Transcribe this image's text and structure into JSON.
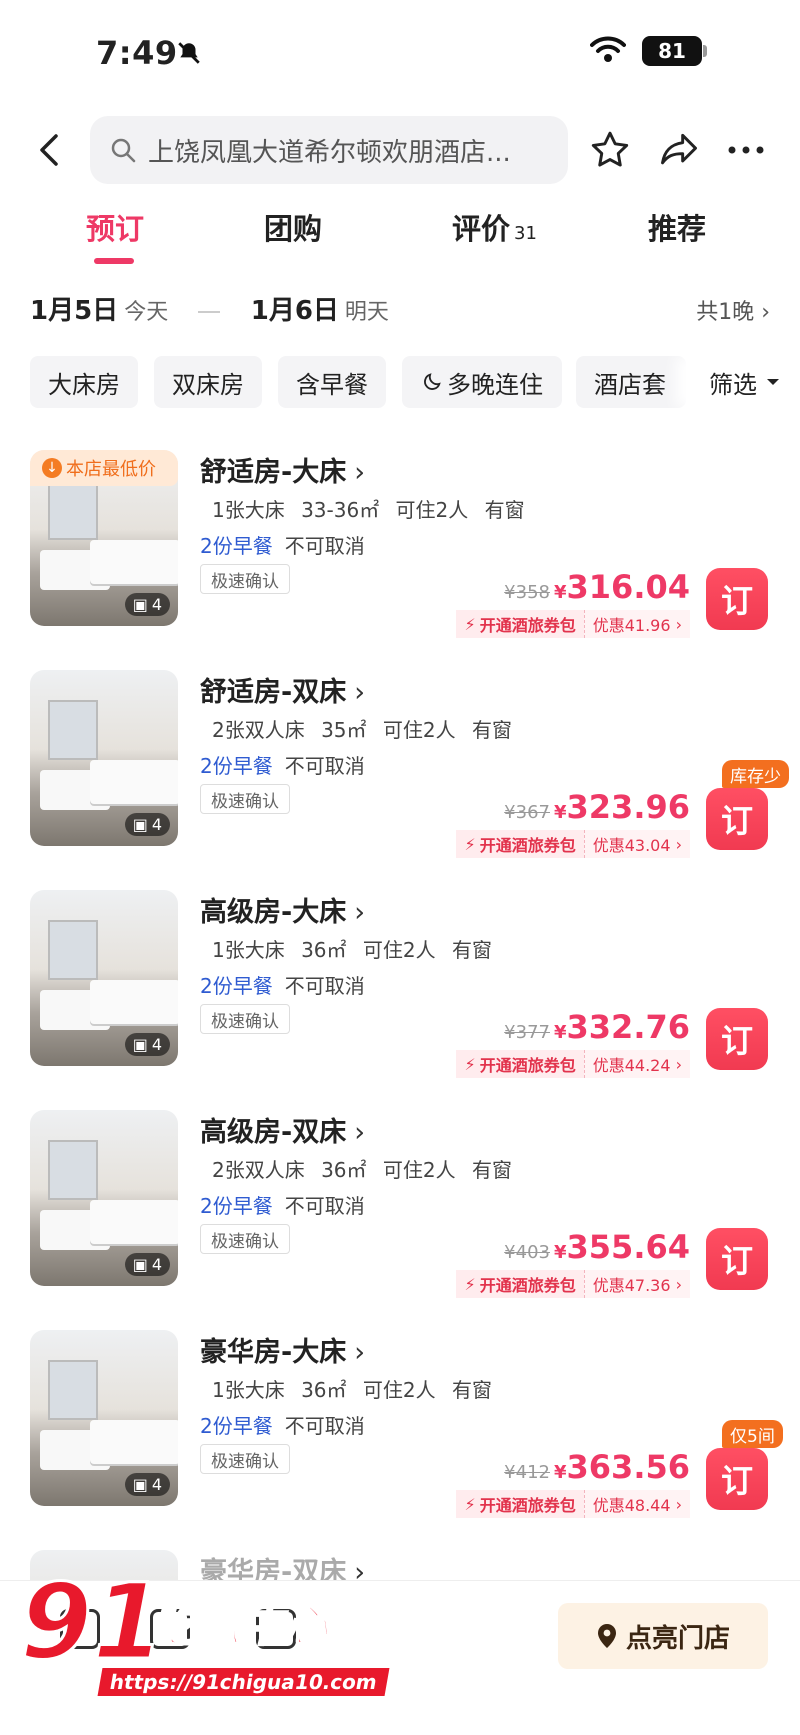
{
  "status_bar": {
    "time": "7:49",
    "battery": "81"
  },
  "header": {
    "search_text": "上饶凤凰大道希尔顿欢朋酒店..."
  },
  "tabs": [
    {
      "label": "预订",
      "count": ""
    },
    {
      "label": "团购",
      "count": ""
    },
    {
      "label": "评价",
      "count": "31"
    },
    {
      "label": "推荐",
      "count": ""
    }
  ],
  "dates": {
    "checkin": "1月5日",
    "checkin_sub": "今天",
    "checkout": "1月6日",
    "checkout_sub": "明天",
    "nights": "共1晚"
  },
  "filters": [
    "大床房",
    "双床房",
    "含早餐",
    "多晚连住",
    "酒店套"
  ],
  "filter_button": "筛选",
  "rooms": [
    {
      "badge": "本店最低价",
      "name": "舒适房-大床",
      "specs": "1张大床 33-36㎡ 可住2人 有窗",
      "breakfast": "2份早餐",
      "cancel": "不可取消",
      "fast": "极速确认",
      "orig": "¥358",
      "price": "316.04",
      "promo_a": "开通酒旅券包",
      "promo_b": "优惠41.96",
      "photos": "4",
      "tag": ""
    },
    {
      "badge": "",
      "name": "舒适房-双床",
      "specs": "2张双人床 35㎡ 可住2人 有窗",
      "breakfast": "2份早餐",
      "cancel": "不可取消",
      "fast": "极速确认",
      "orig": "¥367",
      "price": "323.96",
      "promo_a": "开通酒旅券包",
      "promo_b": "优惠43.04",
      "photos": "4",
      "tag": "库存少"
    },
    {
      "badge": "",
      "name": "高级房-大床",
      "specs": "1张大床 36㎡ 可住2人 有窗",
      "breakfast": "2份早餐",
      "cancel": "不可取消",
      "fast": "极速确认",
      "orig": "¥377",
      "price": "332.76",
      "promo_a": "开通酒旅券包",
      "promo_b": "优惠44.24",
      "photos": "4",
      "tag": ""
    },
    {
      "badge": "",
      "name": "高级房-双床",
      "specs": "2张双人床 36㎡ 可住2人 有窗",
      "breakfast": "2份早餐",
      "cancel": "不可取消",
      "fast": "极速确认",
      "orig": "¥403",
      "price": "355.64",
      "promo_a": "开通酒旅券包",
      "promo_b": "优惠47.36",
      "photos": "4",
      "tag": ""
    },
    {
      "badge": "",
      "name": "豪华房-大床",
      "specs": "1张大床 36㎡ 可住2人 有窗",
      "breakfast": "2份早餐",
      "cancel": "不可取消",
      "fast": "极速确认",
      "orig": "¥412",
      "price": "363.56",
      "promo_a": "开通酒旅券包",
      "promo_b": "优惠48.44",
      "photos": "4",
      "tag": "仅5间"
    },
    {
      "badge": "",
      "name": "豪华房-双床",
      "specs": "",
      "breakfast": "",
      "cancel": "",
      "fast": "",
      "orig": "",
      "price": "",
      "promo_a": "",
      "promo_b": "",
      "photos": "",
      "tag": ""
    }
  ],
  "book_label": "订",
  "currency": "¥",
  "bottom": {
    "light_store": "点亮门店"
  },
  "watermark": {
    "num": "91",
    "text": "吃瓜中心",
    "url": "https://91chigua10.com"
  },
  "colors": {
    "accent": "#ee3966",
    "breakfast": "#2f5bd1",
    "orange": "#f36f1f"
  }
}
